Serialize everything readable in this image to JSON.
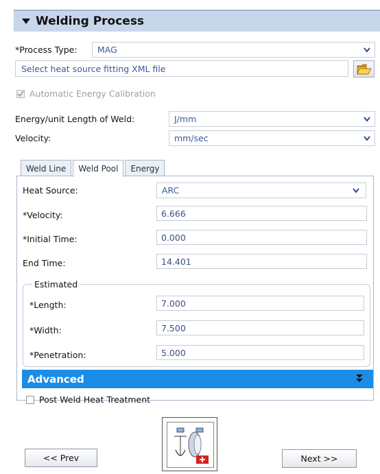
{
  "section": {
    "title": "Welding Process"
  },
  "process": {
    "type_label": "*Process Type:",
    "type_value": "MAG",
    "xml_placeholder": "Select heat source fitting XML file",
    "auto_calibration": "Automatic Energy Calibration",
    "energy_label": "Energy/unit Length of Weld:",
    "energy_unit": "J/mm",
    "velocity_label": "Velocity:",
    "velocity_unit": "mm/sec"
  },
  "tabs": [
    {
      "label": "Weld Line"
    },
    {
      "label": "Weld Pool"
    },
    {
      "label": "Energy"
    }
  ],
  "weld_pool": {
    "heat_source_label": "Heat Source:",
    "heat_source_value": "ARC",
    "velocity_label": "*Velocity:",
    "velocity_value": "6.666",
    "initial_time_label": "*Initial Time:",
    "initial_time_value": "0.000",
    "end_time_label": "End Time:",
    "end_time_value": "14.401",
    "estimated": {
      "legend": "Estimated",
      "length_label": "*Length:",
      "length_value": "7.000",
      "width_label": "*Width:",
      "width_value": "7.500",
      "penetration_label": "*Penetration:",
      "penetration_value": "5.000"
    },
    "advanced_label": "Advanced",
    "pwht_label": "Post Weld Heat Treatment"
  },
  "nav": {
    "prev": "<< Prev",
    "next": "Next >>"
  },
  "colors": {
    "accent": "#1b8de6",
    "header_bg": "#c8d6ea",
    "link_text": "#3a5a9a"
  }
}
